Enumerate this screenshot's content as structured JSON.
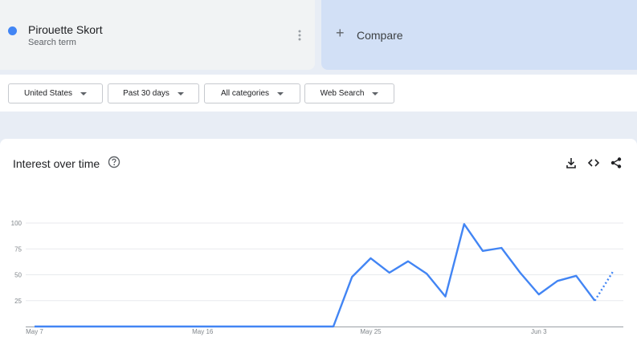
{
  "search_term": {
    "name": "Pirouette Skort",
    "subtitle": "Search term",
    "color": "#4285f4",
    "menu_icon": "more-vert-icon"
  },
  "compare": {
    "label": "Compare",
    "icon": "plus-icon"
  },
  "filters": [
    {
      "label": "United States"
    },
    {
      "label": "Past 30 days"
    },
    {
      "label": "All categories"
    },
    {
      "label": "Web Search"
    }
  ],
  "interest_panel": {
    "title": "Interest over time",
    "help_icon": "help-circle-icon",
    "tool_icons": [
      "download-icon",
      "embed-code-icon",
      "share-icon"
    ]
  },
  "chart_data": {
    "type": "line",
    "title": "Interest over time",
    "ylim": [
      0,
      100
    ],
    "y_ticks": [
      25,
      50,
      75,
      100
    ],
    "x_tick_labels": [
      "May 7",
      "May 16",
      "May 25",
      "Jun 3"
    ],
    "series": [
      {
        "name": "Pirouette Skort",
        "color": "#4285f4",
        "x": [
          "May 7",
          "May 8",
          "May 9",
          "May 10",
          "May 11",
          "May 12",
          "May 13",
          "May 14",
          "May 15",
          "May 16",
          "May 17",
          "May 18",
          "May 19",
          "May 20",
          "May 21",
          "May 22",
          "May 23",
          "May 24",
          "May 25",
          "May 26",
          "May 27",
          "May 28",
          "May 29",
          "May 30",
          "May 31",
          "Jun 1",
          "Jun 2",
          "Jun 3",
          "Jun 4",
          "Jun 5",
          "Jun 6"
        ],
        "values": [
          0,
          0,
          0,
          0,
          0,
          0,
          0,
          0,
          0,
          0,
          0,
          0,
          0,
          0,
          0,
          0,
          0,
          48,
          66,
          52,
          63,
          51,
          29,
          99,
          73,
          76,
          52,
          31,
          44,
          49,
          25
        ],
        "partial": {
          "x": [
            "Jun 6",
            "Jun 7"
          ],
          "values": [
            25,
            54
          ]
        }
      }
    ]
  }
}
